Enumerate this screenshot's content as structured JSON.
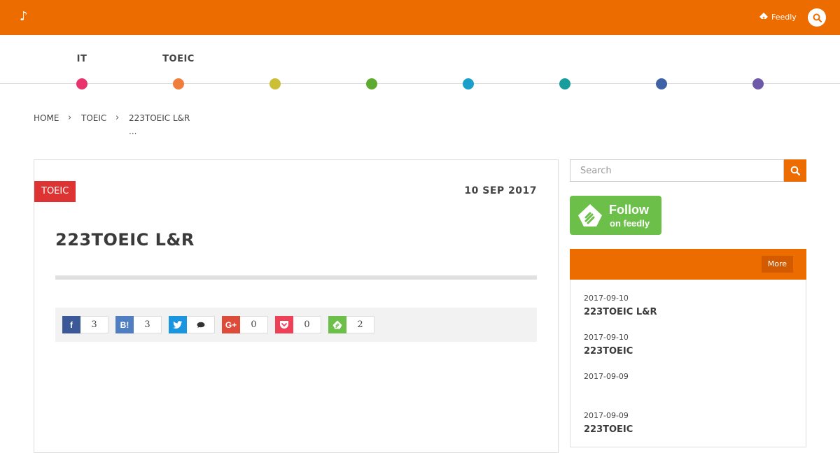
{
  "header": {
    "logo_glyph": "♪",
    "feedly_label": "Feedly",
    "accent_color": "#ec6c00"
  },
  "categories": [
    {
      "label": "IT",
      "color": "#e8336d"
    },
    {
      "label": "TOEIC",
      "color": "#ef7d3c"
    },
    {
      "label": "",
      "color": "#cbbf35"
    },
    {
      "label": "",
      "color": "#5caa2f"
    },
    {
      "label": "",
      "color": "#1a9fcb"
    },
    {
      "label": "",
      "color": "#169d9c"
    },
    {
      "label": "",
      "color": "#3e62a5"
    },
    {
      "label": "",
      "color": "#6e58a8"
    }
  ],
  "breadcrumb": {
    "items": [
      "HOME",
      "TOEIC",
      "223TOEIC L&R"
    ],
    "overflow": "...",
    "separator": "›"
  },
  "article": {
    "category_badge": "TOEIC",
    "date": "10 SEP 2017",
    "title": "223TOEIC L&R"
  },
  "share": [
    {
      "service": "facebook",
      "icon": "facebook-icon",
      "glyph": "f",
      "color": "#3b5998",
      "count": "3"
    },
    {
      "service": "hatena-bookmark",
      "icon": "hatena-bookmark-icon",
      "glyph": "B!",
      "color": "#4f7ec1",
      "count": "3"
    },
    {
      "service": "twitter",
      "icon": "twitter-icon",
      "glyph": "",
      "color": "#1b95e0",
      "count": ""
    },
    {
      "service": "google-plus",
      "icon": "google-plus-icon",
      "glyph": "G+",
      "color": "#dd4b39",
      "count": "0"
    },
    {
      "service": "pocket",
      "icon": "pocket-icon",
      "glyph": "",
      "color": "#ee4056",
      "count": "0"
    },
    {
      "service": "feedly",
      "icon": "feedly-icon",
      "glyph": "",
      "color": "#6cc04a",
      "count": "2"
    }
  ],
  "sidebar": {
    "search_placeholder": "Search",
    "follow_line1": "Follow",
    "follow_line2": "on feedly",
    "more_label": "More",
    "recent": [
      {
        "date": "2017-09-10",
        "title": "223TOEIC L&R"
      },
      {
        "date": "2017-09-10",
        "title": "223TOEIC"
      },
      {
        "date": "2017-09-09",
        "title": ""
      },
      {
        "date": "2017-09-09",
        "title": "223TOEIC"
      }
    ]
  }
}
